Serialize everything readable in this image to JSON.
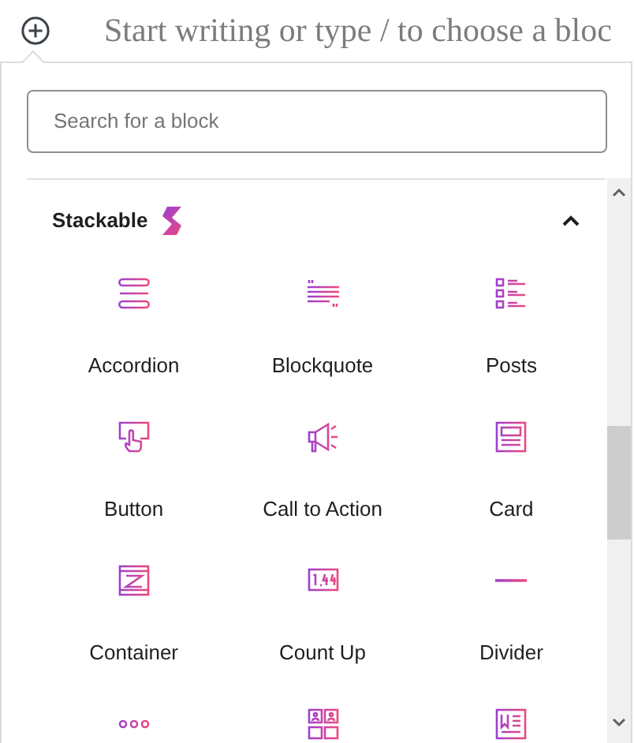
{
  "editor": {
    "placeholder": "Start writing or type / to choose a bloc"
  },
  "inserter": {
    "search": {
      "placeholder": "Search for a block"
    },
    "category": {
      "title": "Stackable",
      "expanded": true
    },
    "blocks": [
      {
        "label": "Accordion"
      },
      {
        "label": "Blockquote"
      },
      {
        "label": "Posts"
      },
      {
        "label": "Button"
      },
      {
        "label": "Call to Action"
      },
      {
        "label": "Card"
      },
      {
        "label": "Container"
      },
      {
        "label": "Count Up"
      },
      {
        "label": "Divider"
      }
    ]
  }
}
